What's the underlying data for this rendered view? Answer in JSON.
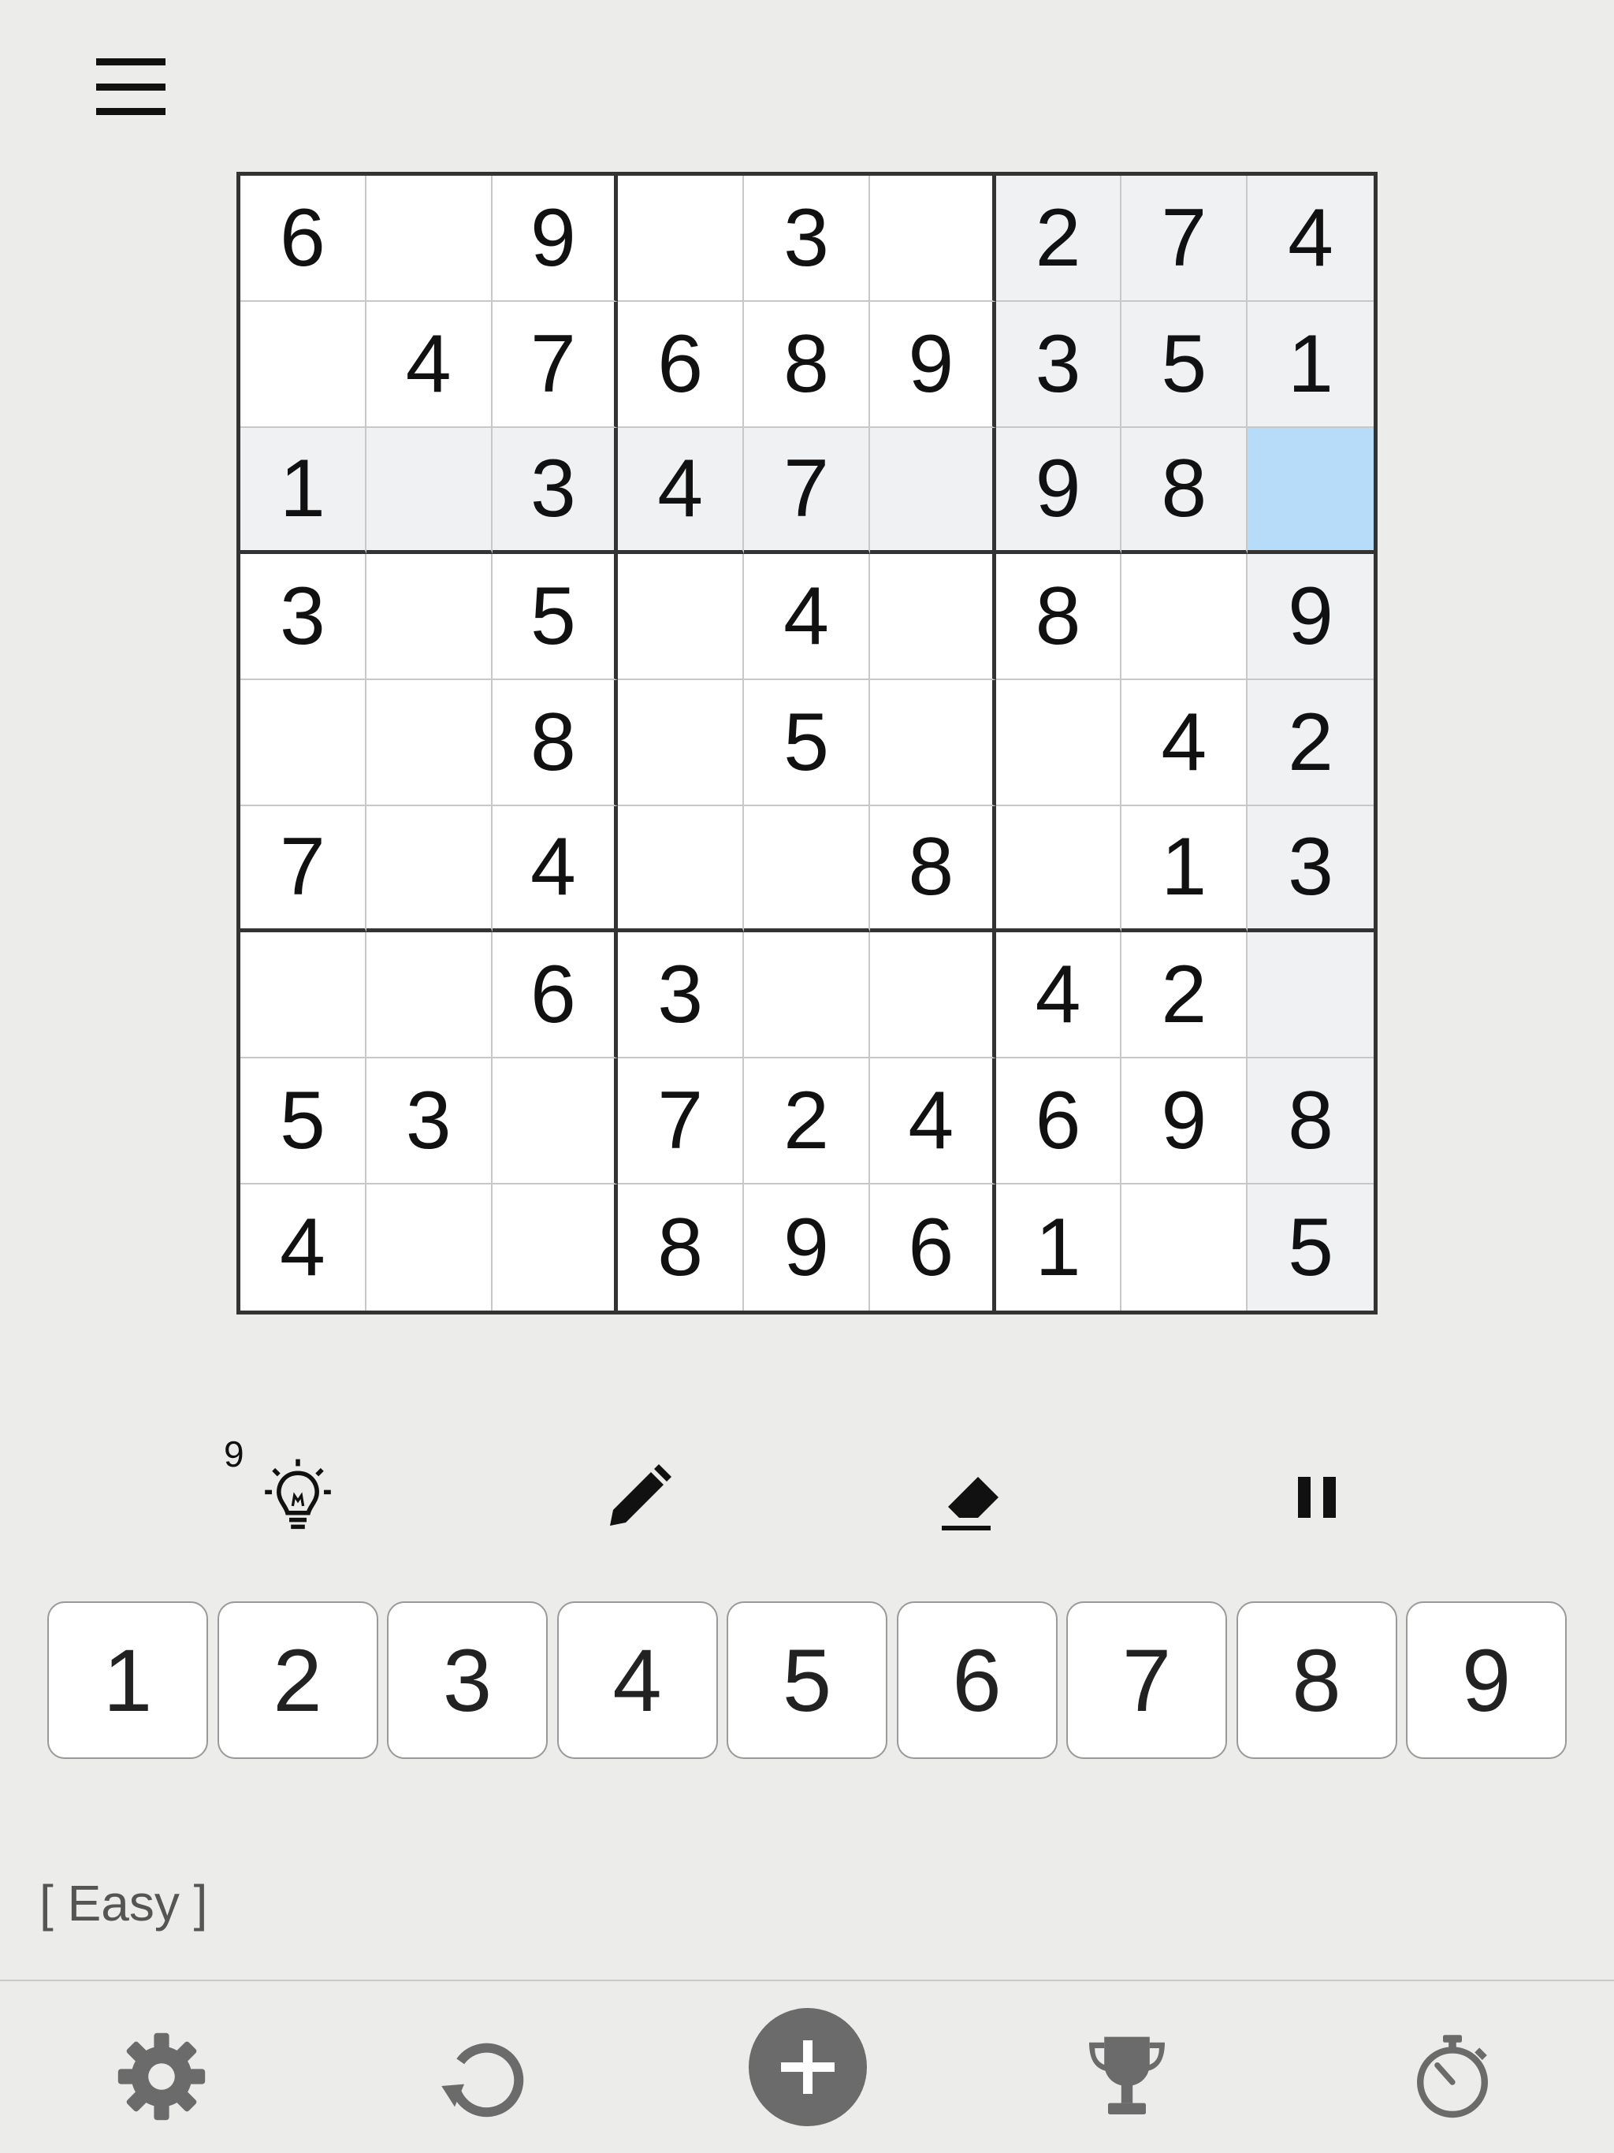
{
  "menu": {
    "icon": "hamburger-menu-icon"
  },
  "board": {
    "rows": [
      [
        "6",
        "",
        "9",
        "",
        "3",
        "",
        "2",
        "7",
        "4"
      ],
      [
        "",
        "4",
        "7",
        "6",
        "8",
        "9",
        "3",
        "5",
        "1"
      ],
      [
        "1",
        "",
        "3",
        "4",
        "7",
        "",
        "9",
        "8",
        ""
      ],
      [
        "3",
        "",
        "5",
        "",
        "4",
        "",
        "8",
        "",
        "9"
      ],
      [
        "",
        "",
        "8",
        "",
        "5",
        "",
        "",
        "4",
        "2"
      ],
      [
        "7",
        "",
        "4",
        "",
        "",
        "8",
        "",
        "1",
        "3"
      ],
      [
        "",
        "",
        "6",
        "3",
        "",
        "",
        "4",
        "2",
        ""
      ],
      [
        "5",
        "3",
        "",
        "7",
        "2",
        "4",
        "6",
        "9",
        "8"
      ],
      [
        "4",
        "",
        "",
        "8",
        "9",
        "6",
        "1",
        "",
        "5"
      ]
    ],
    "selected": {
      "row": 3,
      "col": 9
    },
    "colors": {
      "selected": "#b7dcfa",
      "highlight": "#f0f1f3"
    }
  },
  "toolbar": {
    "hint_count": "9",
    "icons": [
      "lightbulb-icon",
      "pencil-icon",
      "eraser-icon",
      "pause-icon"
    ]
  },
  "numpad": [
    "1",
    "2",
    "3",
    "4",
    "5",
    "6",
    "7",
    "8",
    "9"
  ],
  "difficulty": "[ Easy ]",
  "bottom_nav": {
    "icons": [
      "gear-icon",
      "restart-icon",
      "plus-icon",
      "trophy-icon",
      "stopwatch-icon"
    ],
    "accent": "#6b6b6b"
  }
}
